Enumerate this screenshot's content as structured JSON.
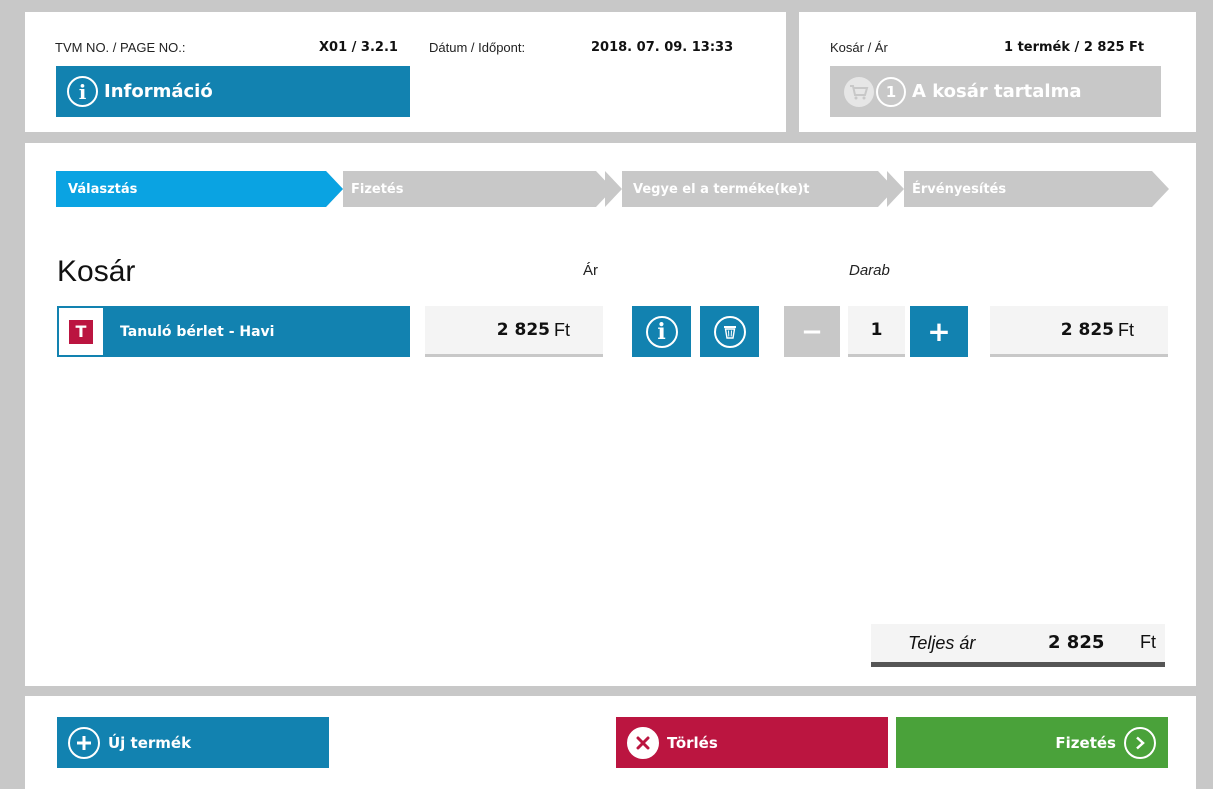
{
  "header": {
    "tvm_label": "TVM NO. / PAGE NO.:",
    "tvm_value": "X01 / 3.2.1",
    "datetime_label": "Dátum / Időpont:",
    "datetime_value": "2018. 07. 09. 13:33",
    "info_icon": "i",
    "info_button": "Információ",
    "cart_label": "Kosár / Ár",
    "cart_value": "1 termék / 2 825 Ft",
    "cart_count": "1",
    "cart_button": "A kosár tartalma"
  },
  "steps": [
    {
      "label": "Választás",
      "active": true
    },
    {
      "label": "Fizetés",
      "active": false
    },
    {
      "label": "Vegye el a terméke(ke)t",
      "active": false
    },
    {
      "label": "Érvényesítés",
      "active": false
    }
  ],
  "cart": {
    "title": "Kosár",
    "price_header": "Ár",
    "qty_header": "Darab",
    "items": [
      {
        "type_badge": "T",
        "name": "Tanuló bérlet - Havi",
        "price": "2 825",
        "currency": "Ft",
        "info_icon": "i",
        "qty_minus": "−",
        "qty": "1",
        "qty_plus": "+",
        "total": "2 825",
        "total_currency": "Ft"
      }
    ],
    "total_label": "Teljes ár",
    "total_value": "2 825",
    "total_currency": "Ft"
  },
  "footer": {
    "new_item": "Új termék",
    "delete": "Törlés",
    "pay": "Fizetés"
  },
  "colors": {
    "blue": "#1282b0",
    "active_step": "#0aa3e2",
    "red": "#bb1540",
    "green": "#4aa23a",
    "gray": "#c8c8c8"
  },
  "icons": [
    "info-icon",
    "cart-icon",
    "trash-icon",
    "plus-circle-icon",
    "x-circle-icon",
    "chevron-right-icon"
  ]
}
